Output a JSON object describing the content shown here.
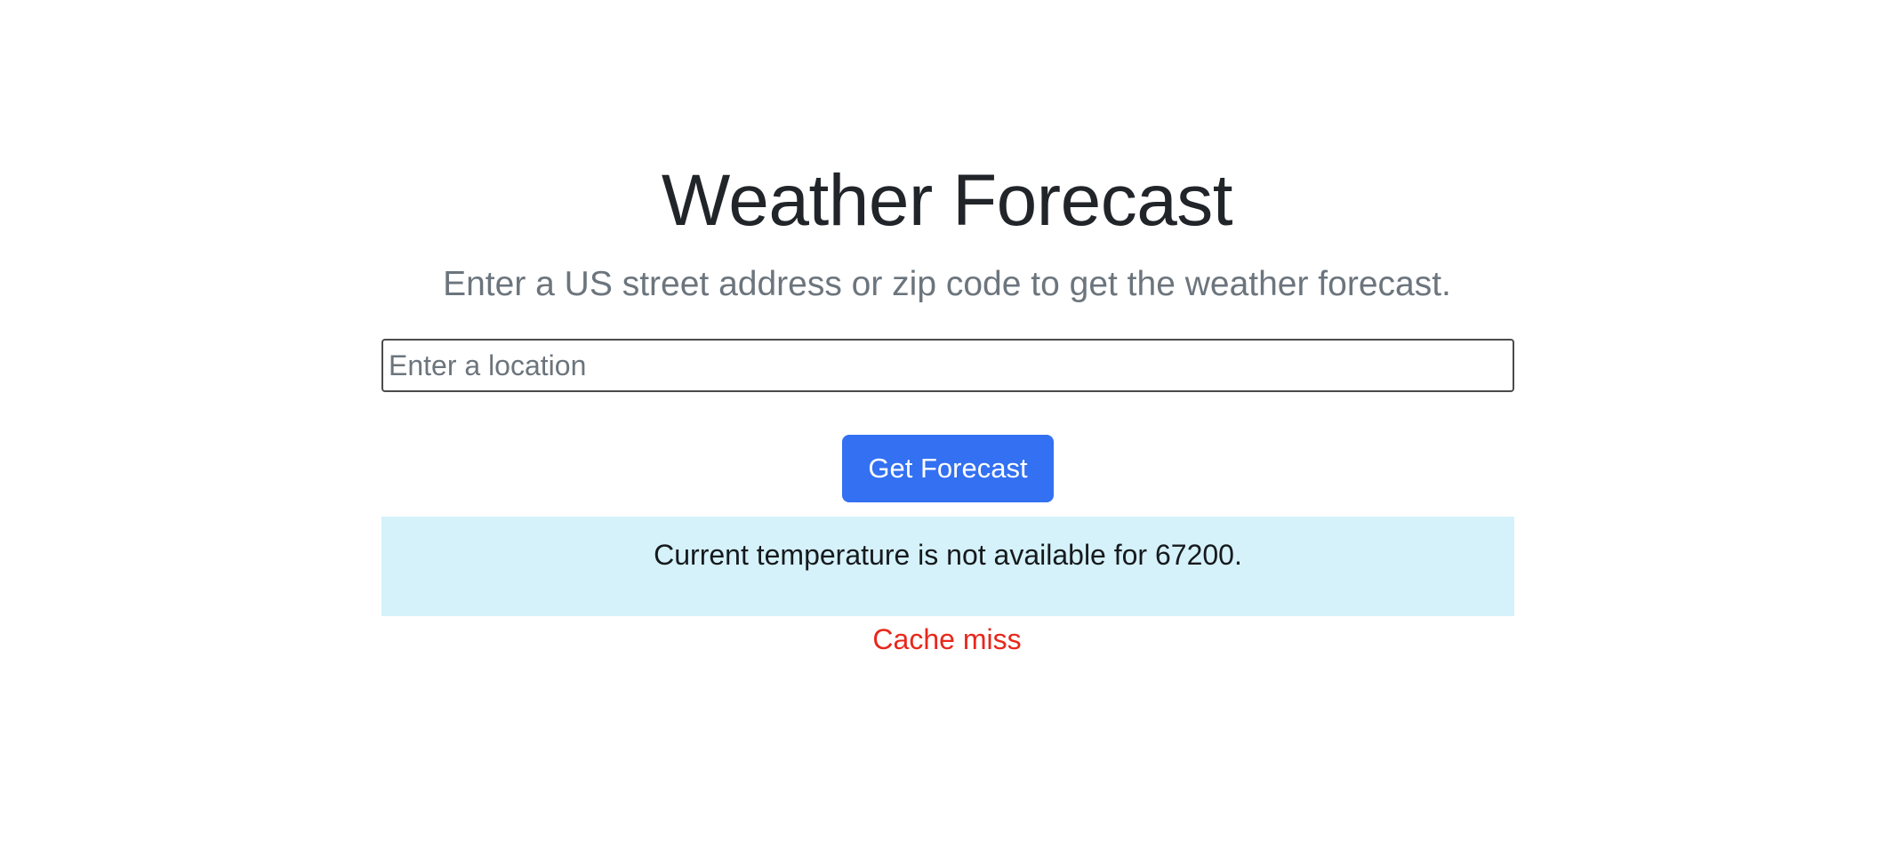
{
  "page": {
    "title": "Weather Forecast",
    "subtitle": "Enter a US street address or zip code to get the weather forecast."
  },
  "search": {
    "value": "",
    "placeholder": "Enter a location"
  },
  "actions": {
    "get_forecast_label": "Get Forecast"
  },
  "result": {
    "message": "Current temperature is not available for 67200.",
    "cache_status": "Cache miss"
  },
  "colors": {
    "button_bg": "#3370f2",
    "alert_bg": "#d5f2fa",
    "cache_status": "#e8271b",
    "title": "#212529",
    "subtitle": "#6c757d"
  }
}
